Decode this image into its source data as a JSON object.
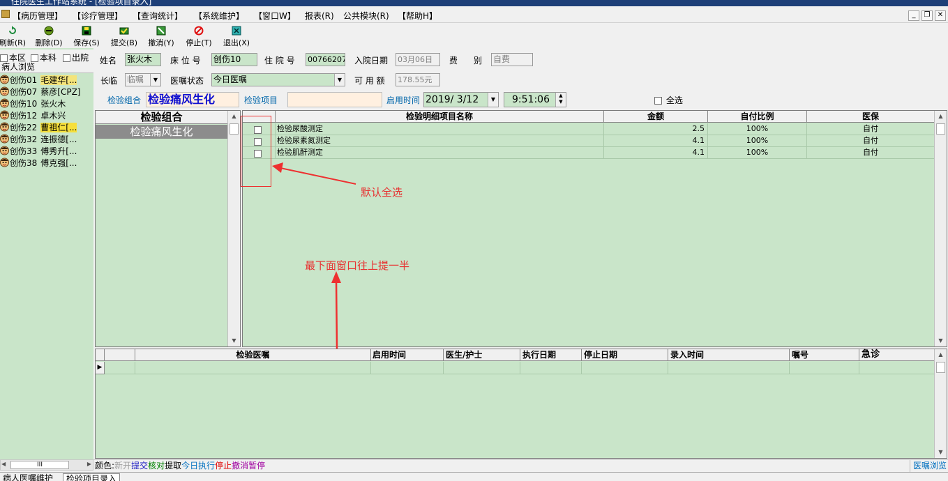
{
  "window": {
    "title": "住院医生工作站系统 - [检验项目录入]"
  },
  "menu": [
    "【病历管理】",
    "【诊疗管理】",
    "【查询统计】",
    "【系统维护】",
    "【窗口W】",
    "报表(R)",
    "公共模块(R)",
    "【帮助H】"
  ],
  "toolbar": [
    {
      "label": "刷新(R)",
      "icon": "refresh-icon"
    },
    {
      "label": "删除(D)",
      "icon": "delete-icon"
    },
    {
      "label": "保存(S)",
      "icon": "save-icon"
    },
    {
      "label": "提交(B)",
      "icon": "submit-icon"
    },
    {
      "label": "撤消(Y)",
      "icon": "undo-icon"
    },
    {
      "label": "停止(T)",
      "icon": "stop-icon"
    },
    {
      "label": "退出(X)",
      "icon": "exit-icon"
    }
  ],
  "left": {
    "filters": [
      "本区",
      "本科",
      "出院"
    ],
    "title": "病人浏览",
    "patients": [
      {
        "bed": "创伤01",
        "name": "毛建华[..."
      },
      {
        "bed": "创伤07",
        "name": "蔡彦[CPZ]"
      },
      {
        "bed": "创伤10",
        "name": "张火木"
      },
      {
        "bed": "创伤12",
        "name": "卓木兴"
      },
      {
        "bed": "创伤22",
        "name": "曹祖仁[..."
      },
      {
        "bed": "创伤32",
        "name": "连振德[..."
      },
      {
        "bed": "创伤33",
        "name": "傅秀升[..."
      },
      {
        "bed": "创伤38",
        "name": "傅克强[..."
      }
    ],
    "scroll_label": "III"
  },
  "form": {
    "name_label": "姓名",
    "name": "张火木",
    "bed_label": "床 位 号",
    "bed": "创伤10",
    "inpatient_label": "住 院 号",
    "inpatient_no": "00766207",
    "admit_label": "入院日期",
    "admit_date": "03月06日",
    "fee_label": "费",
    "fee_label2": "别",
    "fee_type": "自费",
    "term_label": "长临",
    "term": "临嘱",
    "order_status_label": "医嘱状态",
    "order_status": "今日医嘱",
    "balance_label": "可 用 额",
    "balance": "178.55元",
    "group_label": "检验组合",
    "group_value": "检验痛风生化",
    "item_label": "检验项目",
    "item_value": "",
    "start_label": "启用时间",
    "start_date": "2019/ 3/12",
    "start_time": "9:51:06",
    "select_all": "全选"
  },
  "group_grid": {
    "header": "检验组合",
    "rows": [
      "检验痛风生化"
    ]
  },
  "detail_grid": {
    "headers": [
      "",
      "检验明细项目名称",
      "金额",
      "自付比例",
      "医保"
    ],
    "rows": [
      {
        "name": "检验尿酸测定",
        "amount": "2.5",
        "ratio": "100%",
        "insurance": "自付"
      },
      {
        "name": "检验尿素氮测定",
        "amount": "4.1",
        "ratio": "100%",
        "insurance": "自付"
      },
      {
        "name": "检验肌酐测定",
        "amount": "4.1",
        "ratio": "100%",
        "insurance": "自付"
      }
    ]
  },
  "annotations": {
    "select_all_default": "默认全选",
    "raise_window": "最下面窗口往上提一半"
  },
  "order_grid": {
    "headers": [
      "",
      "检验医嘱",
      "启用时间",
      "医生/护士",
      "执行日期",
      "停止日期",
      "录入时间",
      "嘱号",
      "急诊"
    ]
  },
  "status": {
    "prefix": "颜色:",
    "legend": [
      {
        "text": "新开",
        "color": "#a0a0a0"
      },
      {
        "text": "提交",
        "color": "#1010c0"
      },
      {
        "text": "核对",
        "color": "#008000"
      },
      {
        "text": "提取",
        "color": "#000000"
      },
      {
        "text": "今日执行",
        "color": "#0070c0"
      },
      {
        "text": "停止",
        "color": "#e00000"
      },
      {
        "text": "撤消",
        "color": "#a000a0"
      },
      {
        "text": "暂停",
        "color": "#a000a0"
      }
    ],
    "right": "医嘱浏览"
  },
  "bottom_tabs": [
    "病人医嘱维护",
    "检验项目录入"
  ]
}
